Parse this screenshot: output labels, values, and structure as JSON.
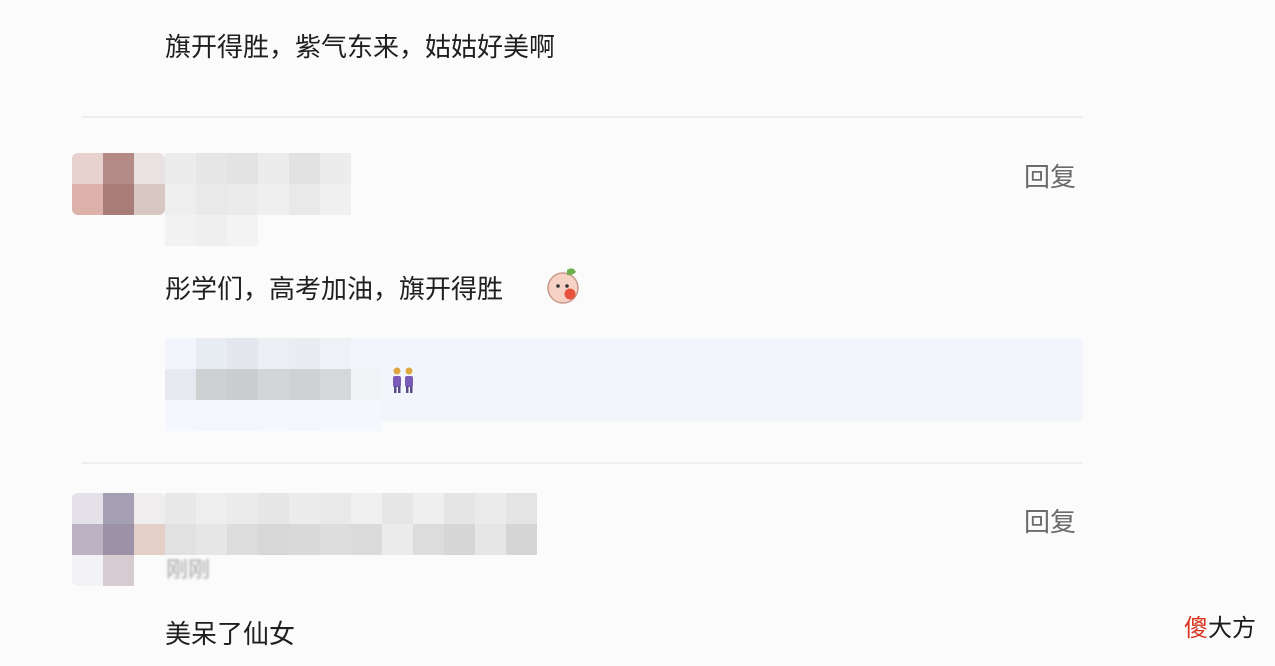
{
  "comments": [
    {
      "text": "旗开得胜，紫气东来，姑姑好美啊"
    },
    {
      "text": "彤学们，高考加油，旗开得胜",
      "reply_label": "回复",
      "emoji": "baby-face-emoji",
      "quote": {
        "icon": "two-people-icon"
      }
    },
    {
      "text": "美呆了仙女",
      "reply_label": "回复",
      "time": "刚刚"
    }
  ],
  "watermark": {
    "part1": "傻",
    "part2": "大方"
  },
  "colors": {
    "divider": "#eeeeee",
    "quote_bg": "#f2f6fc",
    "reply": "#6b6b6b",
    "watermark_accent": "#d9341f"
  }
}
